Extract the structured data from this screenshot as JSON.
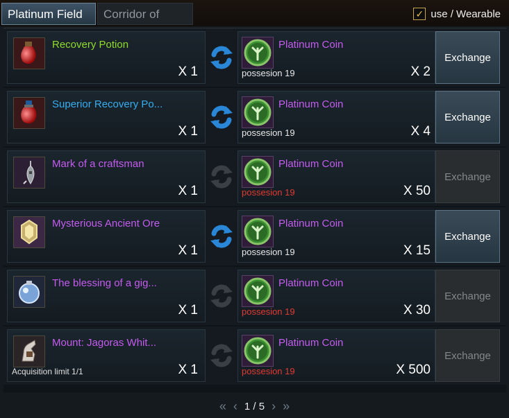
{
  "tabs": [
    {
      "label": "Platinum Field",
      "active": true
    },
    {
      "label": "Corridor of Trials",
      "active": false
    }
  ],
  "filter": {
    "checked": true,
    "label": "use / Wearable"
  },
  "currency_name": "Platinum Coin",
  "exchange_label": "Exchange",
  "possession_label": "possesion 19",
  "colors": {
    "green_name": "#8fdc2a",
    "blue_name": "#35aef1",
    "purple_name": "#c45cf0",
    "possession_warning": "#e23a31"
  },
  "items": [
    {
      "name": "Recovery Potion",
      "name_color": "#8fdc2a",
      "qty": "X 1",
      "cost": "X 2",
      "possession_ok": true,
      "enabled": true,
      "icon": "red-potion-icon",
      "limit": ""
    },
    {
      "name": "Superior Recovery Po...",
      "name_color": "#35aef1",
      "qty": "X 1",
      "cost": "X 4",
      "possession_ok": true,
      "enabled": true,
      "icon": "red-potion-icon",
      "limit": ""
    },
    {
      "name": "Mark of a craftsman",
      "name_color": "#c45cf0",
      "qty": "X 1",
      "cost": "X 50",
      "possession_ok": false,
      "enabled": false,
      "icon": "craftsman-mark-icon",
      "limit": ""
    },
    {
      "name": "Mysterious Ancient Ore",
      "name_color": "#c45cf0",
      "qty": "X 1",
      "cost": "X 15",
      "possession_ok": true,
      "enabled": true,
      "icon": "ancient-ore-icon",
      "limit": ""
    },
    {
      "name": "The blessing of a gig...",
      "name_color": "#c45cf0",
      "qty": "X 1",
      "cost": "X 30",
      "possession_ok": false,
      "enabled": false,
      "icon": "blessing-icon",
      "limit": ""
    },
    {
      "name": "Mount: Jagoras Whit...",
      "name_color": "#c45cf0",
      "qty": "X 1",
      "cost": "X 500",
      "possession_ok": false,
      "enabled": false,
      "icon": "mount-icon",
      "limit": "Acquisition limit 1/1"
    }
  ],
  "pagination": {
    "current": 1,
    "total": 5,
    "text": "1 / 5"
  }
}
